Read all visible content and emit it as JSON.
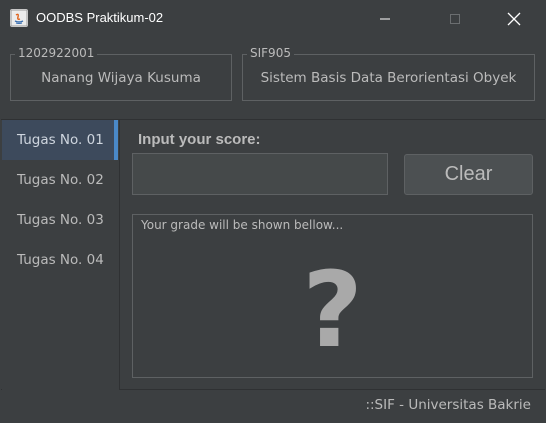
{
  "window": {
    "title": "OODBS Praktikum-02",
    "icons": [
      "java-app-icon",
      "minimize-icon",
      "maximize-icon",
      "close-icon"
    ]
  },
  "student": {
    "id": "1202922001",
    "name": "Nanang Wijaya Kusuma"
  },
  "course": {
    "code": "SIF905",
    "name": "Sistem Basis Data Berorientasi Obyek"
  },
  "sidebar": {
    "items": [
      {
        "label": "Tugas No. 01",
        "selected": true
      },
      {
        "label": "Tugas No. 02",
        "selected": false
      },
      {
        "label": "Tugas No. 03",
        "selected": false
      },
      {
        "label": "Tugas No. 04",
        "selected": false
      }
    ]
  },
  "score": {
    "label": "Input your score:",
    "value": "",
    "clear_label": "Clear"
  },
  "grade": {
    "hint": "Your grade will be shown bellow...",
    "value": "?"
  },
  "footer": "::SIF - Universitas Bakrie",
  "colors": {
    "background": "#3c3f41",
    "selected_item": "#3d4a5c",
    "accent": "#4a88c7",
    "text": "#bbbbbb"
  }
}
